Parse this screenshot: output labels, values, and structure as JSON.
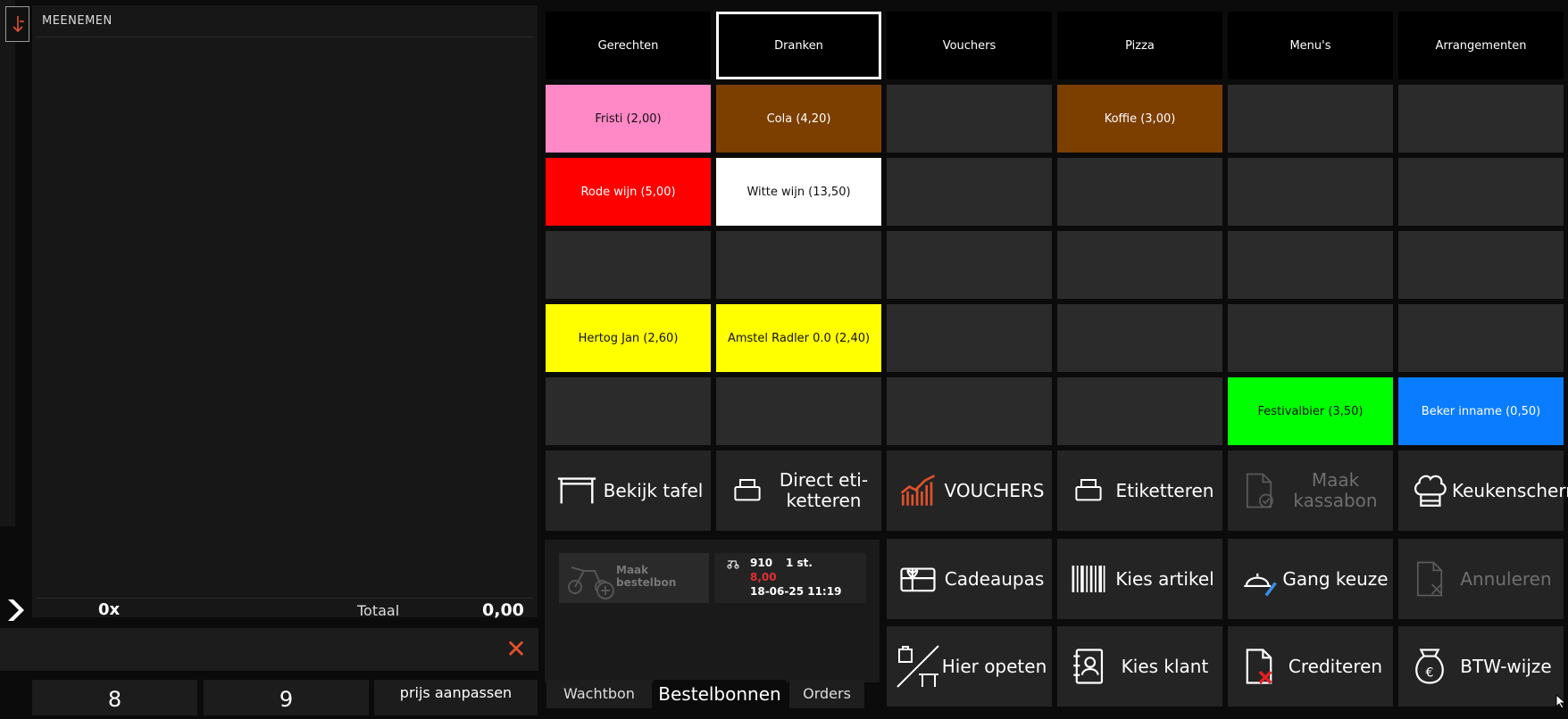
{
  "order": {
    "title": "MEENEMEN",
    "count": "0x",
    "total_label": "Totaal",
    "total_value": "0,00"
  },
  "numpad": [
    {
      "label": "8"
    },
    {
      "label": "9"
    },
    {
      "label": "prijs aanpassen"
    }
  ],
  "categories": [
    {
      "label": "Gerechten",
      "active": false
    },
    {
      "label": "Dranken",
      "active": true
    },
    {
      "label": "Vouchers",
      "active": false
    },
    {
      "label": "Pizza",
      "active": false
    },
    {
      "label": "Menu's",
      "active": false
    },
    {
      "label": "Arrangementen",
      "active": false
    }
  ],
  "products": [
    [
      "Fristi (2,00)",
      "Cola (4,20)",
      "",
      "Koffie (3,00)",
      "",
      ""
    ],
    [
      "Rode wijn (5,00)",
      "Witte wijn (13,50)",
      "",
      "",
      "",
      ""
    ],
    [
      "",
      "",
      "",
      "",
      "",
      ""
    ],
    [
      "Hertog Jan (2,60)",
      "Amstel Radler 0.0 (2,40)",
      "",
      "",
      "",
      ""
    ],
    [
      "",
      "",
      "",
      "",
      "Festivalbier (3,50)",
      "Beker inname (0,50)"
    ]
  ],
  "product_colors": {
    "fristi": "#ff88c6",
    "cola": "#7c3f00",
    "koffie": "#7c3f00",
    "rode_wijn": "#ff0000",
    "witte_wijn": "#ffffff",
    "hertog_jan": "#ffff00",
    "amstel_radler": "#ffff00",
    "festivalbier": "#00ff00",
    "beker_inname": "#0a7cff",
    "empty": "#2b2b2b"
  },
  "actions": [
    {
      "label": "Bekijk tafel",
      "icon": "table-icon",
      "disabled": false
    },
    {
      "label": "Direct eti-ketteren",
      "icon": "printer-icon",
      "disabled": false
    },
    {
      "label": "VOUCHERS",
      "icon": "chart-icon",
      "disabled": false
    },
    {
      "label": "Etiketteren",
      "icon": "printer-icon",
      "disabled": false
    },
    {
      "label": "Maak kassabon",
      "icon": "receipt-check-icon",
      "disabled": true
    },
    {
      "label": "Keukenscherm",
      "icon": "chef-hat-icon",
      "disabled": false
    },
    {
      "label": "Cadeaupas",
      "icon": "gift-card-icon",
      "disabled": false
    },
    {
      "label": "Kies artikel",
      "icon": "barcode-icon",
      "disabled": false
    },
    {
      "label": "Gang keuze",
      "icon": "cloche-icon",
      "disabled": false
    },
    {
      "label": "Annuleren",
      "icon": "doc-cancel-icon",
      "disabled": true
    },
    {
      "label": "Hier opeten",
      "icon": "dine-in-icon",
      "disabled": false
    },
    {
      "label": "Kies klant",
      "icon": "contact-icon",
      "disabled": false
    },
    {
      "label": "Crediteren",
      "icon": "doc-credit-icon",
      "disabled": false
    },
    {
      "label": "BTW-wijze",
      "icon": "money-bag-icon",
      "disabled": false
    }
  ],
  "tickets": {
    "maak_bestelbon": "Maak bestelbon",
    "card": {
      "number": "910",
      "qty": "1 st.",
      "amount": "8,00",
      "datetime": "18-06-25 11:19"
    },
    "tabs": [
      "Wachtbon",
      "Bestelbonnen",
      "Orders"
    ],
    "active_tab": "Bestelbonnen"
  }
}
